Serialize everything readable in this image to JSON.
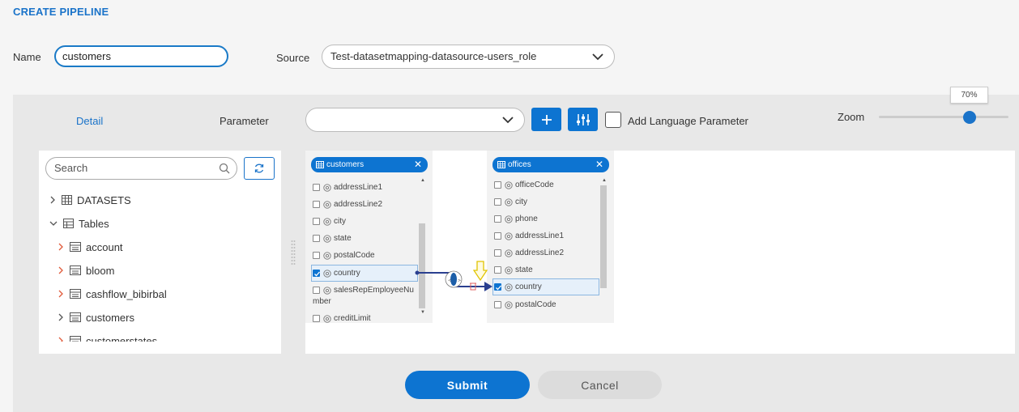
{
  "page_title": "CREATE PIPELINE",
  "name_field": {
    "label": "Name",
    "value": "customers"
  },
  "source_field": {
    "label": "Source",
    "value": "Test-datasetmapping-datasource-users_role"
  },
  "toolbar": {
    "detail_tab": "Detail",
    "parameter_label": "Parameter",
    "parameter_value": "",
    "add_language_parameter": "Add Language Parameter",
    "zoom_label": "Zoom",
    "zoom_value": "70%",
    "zoom_level": 0.7
  },
  "search": {
    "placeholder": "Search"
  },
  "tree": {
    "datasets_label": "DATASETS",
    "tables_label": "Tables",
    "tables": [
      "account",
      "bloom",
      "cashflow_bibirbal",
      "customers",
      "customerstates"
    ]
  },
  "mapping": {
    "left_table": {
      "name": "customers",
      "fields": [
        {
          "label": "addressLine1",
          "checked": false
        },
        {
          "label": "addressLine2",
          "checked": false
        },
        {
          "label": "city",
          "checked": false
        },
        {
          "label": "state",
          "checked": false
        },
        {
          "label": "postalCode",
          "checked": false
        },
        {
          "label": "country",
          "checked": true
        },
        {
          "label": "salesRepEmployeeNu",
          "checked": false
        },
        {
          "label": "mber",
          "checked": false
        },
        {
          "label": "creditLimit",
          "checked": false
        }
      ]
    },
    "right_table": {
      "name": "offices",
      "fields": [
        {
          "label": "officeCode",
          "checked": false
        },
        {
          "label": "city",
          "checked": false
        },
        {
          "label": "phone",
          "checked": false
        },
        {
          "label": "addressLine1",
          "checked": false
        },
        {
          "label": "addressLine2",
          "checked": false
        },
        {
          "label": "state",
          "checked": false
        },
        {
          "label": "country",
          "checked": true
        },
        {
          "label": "postalCode",
          "checked": false
        }
      ]
    }
  },
  "actions": {
    "submit": "Submit",
    "cancel": "Cancel"
  },
  "colors": {
    "accent": "#0d74d1",
    "link": "#1a73c9"
  }
}
